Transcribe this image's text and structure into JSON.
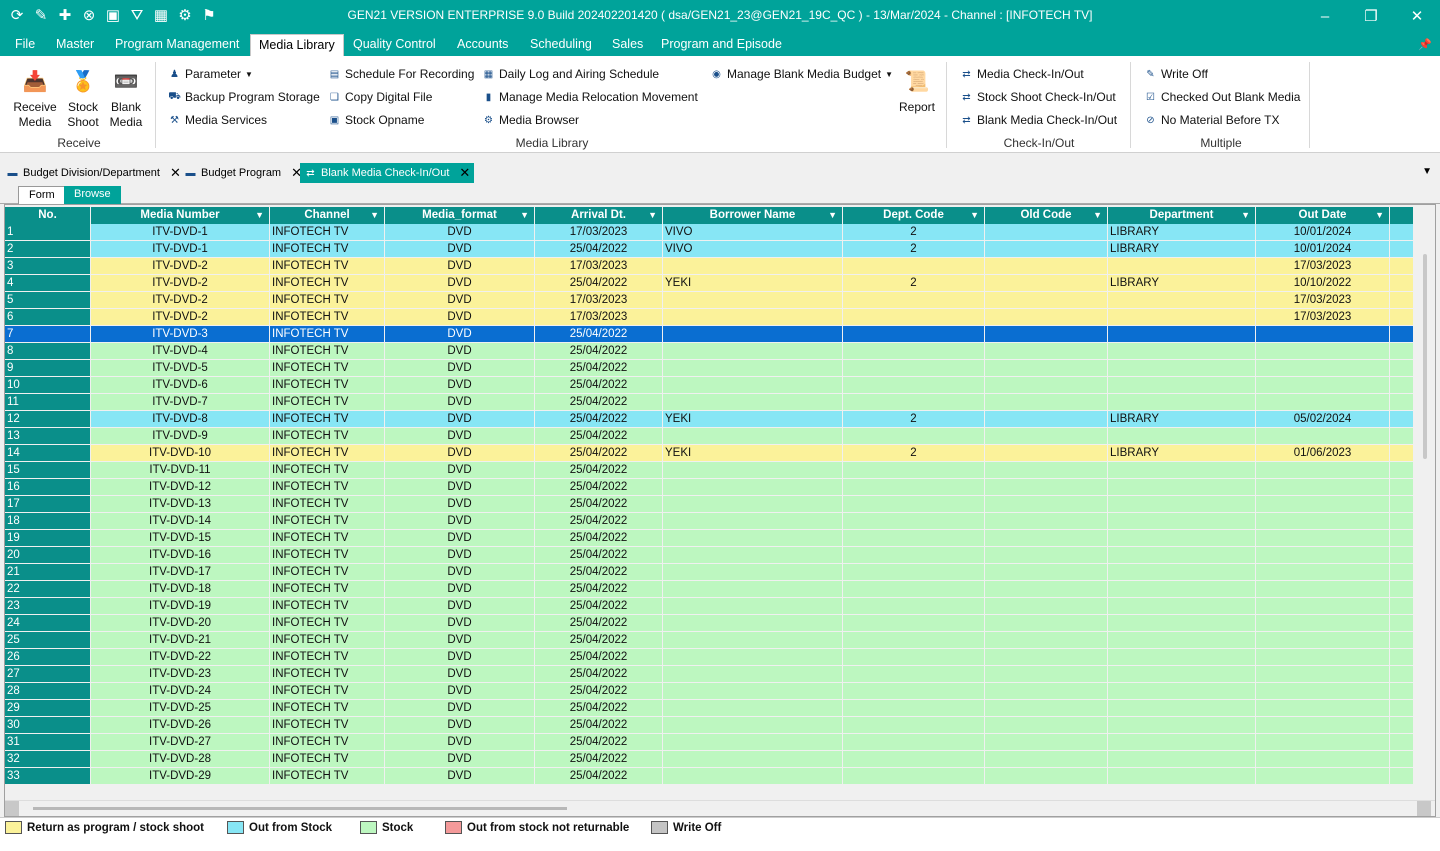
{
  "window": {
    "title": "GEN21 VERSION ENTERPRISE 9.0 Build 202402201420 ( dsa/GEN21_23@GEN21_19C_QC ) - 13/Mar/2024 - Channel : [INFOTECH TV]"
  },
  "menu": [
    "File",
    "Master",
    "Program Management",
    "Media Library",
    "Quality Control",
    "Accounts",
    "Scheduling",
    "Sales",
    "Program and Episode"
  ],
  "ribbon": {
    "receive_group": {
      "label": "Receive",
      "buttons": [
        "Receive\nMedia",
        "Stock\nShoot",
        "Blank\nMedia"
      ]
    },
    "media_library_group": {
      "label": "Media Library",
      "col1": [
        "Parameter",
        "Backup Program Storage",
        "Media Services"
      ],
      "col2": [
        "Schedule For Recording",
        "Copy Digital File",
        "Stock Opname"
      ],
      "col3": [
        "Daily Log and Airing Schedule",
        "Manage Media Relocation Movement",
        "Media Browser"
      ],
      "col4": [
        "Manage Blank Media Budget"
      ],
      "report": "Report"
    },
    "checkinout_group": {
      "label": "Check-In/Out",
      "items": [
        "Media Check-In/Out",
        "Stock Shoot Check-In/Out",
        "Blank Media Check-In/Out"
      ]
    },
    "multiple_group": {
      "label": "Multiple",
      "items": [
        "Write Off",
        "Checked Out Blank Media",
        "No Material Before TX"
      ]
    }
  },
  "doc_tabs": [
    "Budget Division/Department",
    "Budget Program",
    "Blank Media Check-In/Out"
  ],
  "view_tabs": {
    "form": "Form",
    "browse": "Browse"
  },
  "grid": {
    "columns": [
      "No.",
      "Media Number",
      "Channel",
      "Media_format",
      "Arrival Dt.",
      "Borrower Name",
      "Dept. Code",
      "Old Code",
      "Department",
      "Out Date"
    ],
    "rows": [
      [
        "1",
        "ITV-DVD-1",
        "INFOTECH TV",
        "DVD",
        "17/03/2023",
        "VIVO",
        "2",
        "",
        "LIBRARY",
        "10/01/2024",
        "blue"
      ],
      [
        "2",
        "ITV-DVD-1",
        "INFOTECH TV",
        "DVD",
        "25/04/2022",
        "VIVO",
        "2",
        "",
        "LIBRARY",
        "10/01/2024",
        "blue"
      ],
      [
        "3",
        "ITV-DVD-2",
        "INFOTECH TV",
        "DVD",
        "17/03/2023",
        "",
        "",
        "",
        "",
        "17/03/2023",
        "yellow"
      ],
      [
        "4",
        "ITV-DVD-2",
        "INFOTECH TV",
        "DVD",
        "25/04/2022",
        "YEKI",
        "2",
        "",
        "LIBRARY",
        "10/10/2022",
        "yellow"
      ],
      [
        "5",
        "ITV-DVD-2",
        "INFOTECH TV",
        "DVD",
        "17/03/2023",
        "",
        "",
        "",
        "",
        "17/03/2023",
        "yellow"
      ],
      [
        "6",
        "ITV-DVD-2",
        "INFOTECH TV",
        "DVD",
        "17/03/2023",
        "",
        "",
        "",
        "",
        "17/03/2023",
        "yellow"
      ],
      [
        "7",
        "ITV-DVD-3",
        "INFOTECH TV",
        "DVD",
        "25/04/2022",
        "",
        "",
        "",
        "",
        "",
        "selected"
      ],
      [
        "8",
        "ITV-DVD-4",
        "INFOTECH TV",
        "DVD",
        "25/04/2022",
        "",
        "",
        "",
        "",
        "",
        "green"
      ],
      [
        "9",
        "ITV-DVD-5",
        "INFOTECH TV",
        "DVD",
        "25/04/2022",
        "",
        "",
        "",
        "",
        "",
        "green"
      ],
      [
        "10",
        "ITV-DVD-6",
        "INFOTECH TV",
        "DVD",
        "25/04/2022",
        "",
        "",
        "",
        "",
        "",
        "green"
      ],
      [
        "11",
        "ITV-DVD-7",
        "INFOTECH TV",
        "DVD",
        "25/04/2022",
        "",
        "",
        "",
        "",
        "",
        "green"
      ],
      [
        "12",
        "ITV-DVD-8",
        "INFOTECH TV",
        "DVD",
        "25/04/2022",
        "YEKI",
        "2",
        "",
        "LIBRARY",
        "05/02/2024",
        "blue"
      ],
      [
        "13",
        "ITV-DVD-9",
        "INFOTECH TV",
        "DVD",
        "25/04/2022",
        "",
        "",
        "",
        "",
        "",
        "green"
      ],
      [
        "14",
        "ITV-DVD-10",
        "INFOTECH TV",
        "DVD",
        "25/04/2022",
        "YEKI",
        "2",
        "",
        "LIBRARY",
        "01/06/2023",
        "yellow"
      ],
      [
        "15",
        "ITV-DVD-11",
        "INFOTECH TV",
        "DVD",
        "25/04/2022",
        "",
        "",
        "",
        "",
        "",
        "green"
      ],
      [
        "16",
        "ITV-DVD-12",
        "INFOTECH TV",
        "DVD",
        "25/04/2022",
        "",
        "",
        "",
        "",
        "",
        "green"
      ],
      [
        "17",
        "ITV-DVD-13",
        "INFOTECH TV",
        "DVD",
        "25/04/2022",
        "",
        "",
        "",
        "",
        "",
        "green"
      ],
      [
        "18",
        "ITV-DVD-14",
        "INFOTECH TV",
        "DVD",
        "25/04/2022",
        "",
        "",
        "",
        "",
        "",
        "green"
      ],
      [
        "19",
        "ITV-DVD-15",
        "INFOTECH TV",
        "DVD",
        "25/04/2022",
        "",
        "",
        "",
        "",
        "",
        "green"
      ],
      [
        "20",
        "ITV-DVD-16",
        "INFOTECH TV",
        "DVD",
        "25/04/2022",
        "",
        "",
        "",
        "",
        "",
        "green"
      ],
      [
        "21",
        "ITV-DVD-17",
        "INFOTECH TV",
        "DVD",
        "25/04/2022",
        "",
        "",
        "",
        "",
        "",
        "green"
      ],
      [
        "22",
        "ITV-DVD-18",
        "INFOTECH TV",
        "DVD",
        "25/04/2022",
        "",
        "",
        "",
        "",
        "",
        "green"
      ],
      [
        "23",
        "ITV-DVD-19",
        "INFOTECH TV",
        "DVD",
        "25/04/2022",
        "",
        "",
        "",
        "",
        "",
        "green"
      ],
      [
        "24",
        "ITV-DVD-20",
        "INFOTECH TV",
        "DVD",
        "25/04/2022",
        "",
        "",
        "",
        "",
        "",
        "green"
      ],
      [
        "25",
        "ITV-DVD-21",
        "INFOTECH TV",
        "DVD",
        "25/04/2022",
        "",
        "",
        "",
        "",
        "",
        "green"
      ],
      [
        "26",
        "ITV-DVD-22",
        "INFOTECH TV",
        "DVD",
        "25/04/2022",
        "",
        "",
        "",
        "",
        "",
        "green"
      ],
      [
        "27",
        "ITV-DVD-23",
        "INFOTECH TV",
        "DVD",
        "25/04/2022",
        "",
        "",
        "",
        "",
        "",
        "green"
      ],
      [
        "28",
        "ITV-DVD-24",
        "INFOTECH TV",
        "DVD",
        "25/04/2022",
        "",
        "",
        "",
        "",
        "",
        "green"
      ],
      [
        "29",
        "ITV-DVD-25",
        "INFOTECH TV",
        "DVD",
        "25/04/2022",
        "",
        "",
        "",
        "",
        "",
        "green"
      ],
      [
        "30",
        "ITV-DVD-26",
        "INFOTECH TV",
        "DVD",
        "25/04/2022",
        "",
        "",
        "",
        "",
        "",
        "green"
      ],
      [
        "31",
        "ITV-DVD-27",
        "INFOTECH TV",
        "DVD",
        "25/04/2022",
        "",
        "",
        "",
        "",
        "",
        "green"
      ],
      [
        "32",
        "ITV-DVD-28",
        "INFOTECH TV",
        "DVD",
        "25/04/2022",
        "",
        "",
        "",
        "",
        "",
        "green"
      ],
      [
        "33",
        "ITV-DVD-29",
        "INFOTECH TV",
        "DVD",
        "25/04/2022",
        "",
        "",
        "",
        "",
        "",
        "green"
      ]
    ]
  },
  "colors": {
    "blue": "#87e6f5",
    "yellow": "#fbf29a",
    "green": "#bdf7c0",
    "selected": "#0a6ed1",
    "accent": "#00a39a"
  },
  "legend": [
    {
      "label": "Return as program / stock shoot",
      "color": "#fbf29a"
    },
    {
      "label": "Out from Stock",
      "color": "#87e6f5"
    },
    {
      "label": "Stock",
      "color": "#bdf7c0"
    },
    {
      "label": "Out from stock not returnable",
      "color": "#f49a9a"
    },
    {
      "label": "Write Off",
      "color": "#c4c4c4"
    }
  ]
}
